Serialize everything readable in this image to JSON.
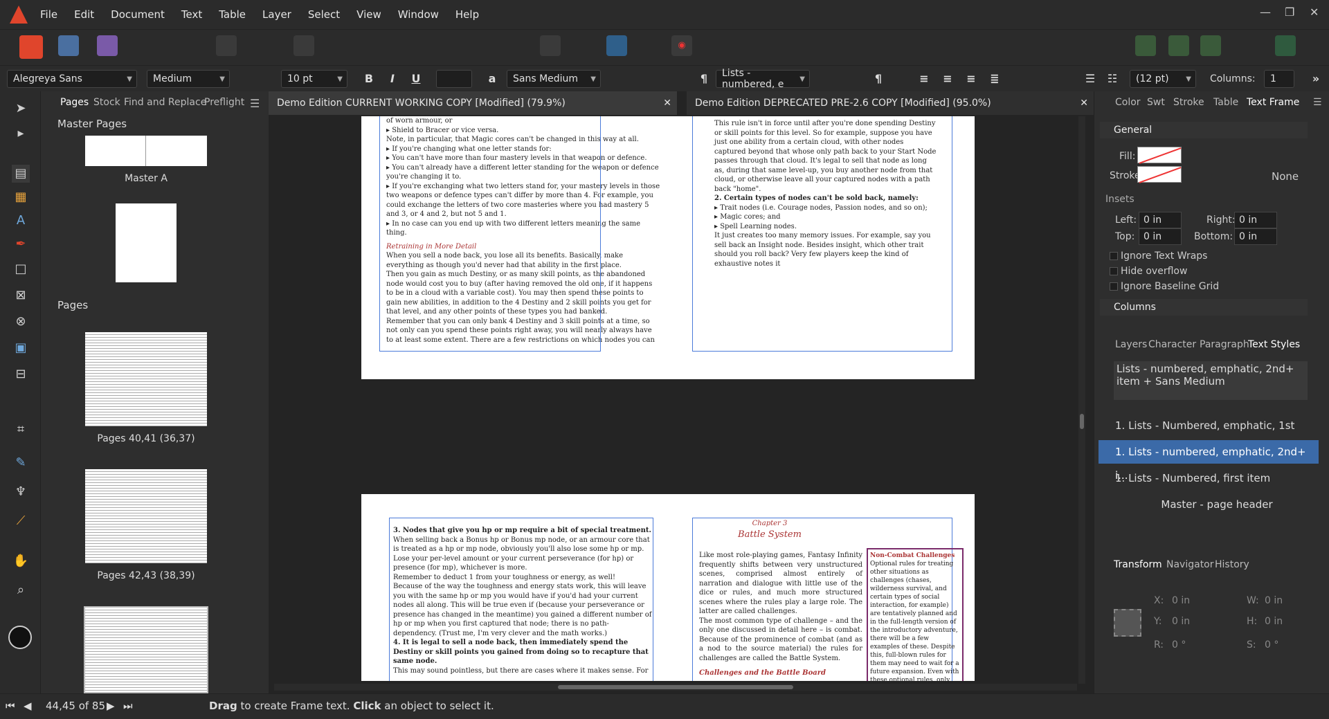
{
  "menu": [
    "File",
    "Edit",
    "Document",
    "Text",
    "Table",
    "Layer",
    "Select",
    "View",
    "Window",
    "Help"
  ],
  "ctx": {
    "font": "Alegreya Sans",
    "weight": "Medium",
    "size": "10 pt",
    "charstyle": "Sans Medium",
    "parastyle": "Lists - numbered, e",
    "leading": "(12 pt)",
    "columns_label": "Columns:",
    "columns_value": "1"
  },
  "left": {
    "tabs": [
      "Pages",
      "Stock",
      "Find and Replace",
      "Preflight"
    ],
    "master_header": "Master Pages",
    "master_label": "Master A",
    "pages_header": "Pages",
    "spreads": [
      "Pages 40,41 (36,37)",
      "Pages 42,43 (38,39)"
    ]
  },
  "doc": {
    "tab1": "Demo Edition CURRENT WORKING COPY [Modified] (79.9%)",
    "tab2": "Demo Edition DEPRECATED PRE-2.6 COPY [Modified] (95.0%)",
    "p1": [
      "of worn armour, or",
      "▸ Shield to Bracer or vice versa.",
      "Note, in particular, that Magic cores can't be changed in this way at all.",
      "▸ If you're changing what one letter stands for:",
      "▸ You can't have more than four mastery levels in that weapon or defence.",
      "▸ You can't already have a different letter standing for the weapon or defence you're changing it to.",
      "▸ If you're exchanging what two letters stand for, your mastery levels in those two weapons or defence types can't differ by more than 4. For example, you could exchange the letters of two core masteries where you had mastery 5 and 3, or 4 and 2, but not 5 and 1.",
      "▸ In no case can you end up with two different letters meaning the same thing."
    ],
    "p1_head": "Retraining in More Detail",
    "p1b": [
      "When you sell a node back, you lose all its benefits. Basically, make everything as though you'd never had that ability in the first place.",
      "Then you gain as much Destiny, or as many skill points, as the abandoned node would cost you to buy (after having removed the old one, if it happens to be in a cloud with a variable cost). You may then spend these points to gain new abilities, in addition to the 4 Destiny and 2 skill points you get for that level, and any other points of these types you had banked.",
      "Remember that you can only bank 4 Destiny and 3 skill points at a time, so not only can you spend these points right away, you will nearly always have to at least some extent. There are a few restrictions on which nodes you can"
    ],
    "p2": [
      "This rule isn't in force until after you're done spending Destiny or skill points for this level. So for example, suppose you have just one ability from a certain cloud, with other nodes captured beyond that whose only path back to your Start Node passes through that cloud. It's legal to sell that node as long as, during that same level-up, you buy another node from that cloud, or otherwise leave all your captured nodes with a path back \"home\".",
      "2. Certain types of nodes can't be sold back, namely:",
      "▸ Trait nodes (i.e. Courage nodes, Passion nodes, and so on);",
      "▸ Magic cores; and",
      "▸ Spell Learning nodes.",
      "It just creates too many memory issues. For example, say you sell back an Insight node. Besides insight, which other trait should you roll back? Very few players keep the kind of exhaustive notes it"
    ],
    "p3": [
      "3. Nodes that give you hp or mp require a bit of special treatment.",
      "When selling back a Bonus hp or Bonus mp node, or an armour core that is treated as a hp or mp node, obviously you'll also lose some hp or mp. Lose your per-level amount or your current perseverance (for hp) or presence (for mp), whichever is more.",
      "Remember to deduct 1 from your toughness or energy, as well!",
      "Because of the way the toughness and energy stats work, this will leave you with the same hp or mp you would have if you'd had your current nodes all along. This will be true even if (because your perseverance or presence has changed in the meantime) you gained a different number of hp or mp when you first captured that node; there is no path-dependency. (Trust me, I'm very clever and the math works.)",
      "4. It is legal to sell a node back, then immediately spend the Destiny or skill points you gained from doing so to recapture that same node.",
      "This may sound pointless, but there are cases where it makes sense. For"
    ],
    "p4_chapter": "Chapter 3",
    "p4_title": "Battle System",
    "p4": [
      "Like most role-playing games, Fantasy Infinity frequently shifts between very unstructured scenes, comprised almost entirely of narration and dialogue with little use of the dice or rules, and much more structured scenes where the rules play a large role. The latter are called challenges.",
      "The most common type of challenge – and the only one discussed in detail here – is combat. Because of the prominence of combat (and as a nod to the source material) the rules for challenges are called the Battle System."
    ],
    "p4_sub": "Challenges and the Battle Board",
    "sidebar_title": "Non-Combat Challenges",
    "sidebar": "Optional rules for treating other situations as challenges (chases, wilderness survival, and certain types of social interaction, for example) are tentatively planned and in the full-length version of the introductory adventure, there will be a few examples of these. Despite this, full-blown rules for them may need to wait for a future expansion. Even with these optional rules, only the most complex or high-stakes social interactions, traps, or"
  },
  "right": {
    "tabs1": [
      "Color",
      "Swt",
      "Stroke",
      "Table",
      "Text Frame"
    ],
    "general": "General",
    "fill": "Fill:",
    "stroke": "Stroke:",
    "none": "None",
    "insets": "Insets",
    "left": "Left:",
    "right": "Right:",
    "top": "Top:",
    "bottom": "Bottom:",
    "zero": "0 in",
    "checks": [
      "Ignore Text Wraps",
      "Hide overflow",
      "Ignore Baseline Grid"
    ],
    "columns": "Columns",
    "tabs2": [
      "Layers",
      "Character",
      "Paragraph",
      "Text Styles"
    ],
    "current_style": "Lists - numbered, emphatic, 2nd+ item + Sans Medium",
    "styles": [
      "1. Lists - Numbered, emphatic, 1st ite...",
      "1. Lists - numbered, emphatic, 2nd+ i...",
      "1. Lists - Numbered, first item",
      "Master - page header"
    ],
    "tabs3": [
      "Transform",
      "Navigator",
      "History"
    ],
    "x": "X:",
    "y": "Y:",
    "w": "W:",
    "h": "H:",
    "r": "R:",
    "s": "S:",
    "deg": "0 °"
  },
  "status": {
    "pages": "44,45 of 85",
    "hint_drag": "Drag",
    "hint1": " to create Frame text. ",
    "hint_click": "Click",
    "hint2": " an object to select it."
  }
}
